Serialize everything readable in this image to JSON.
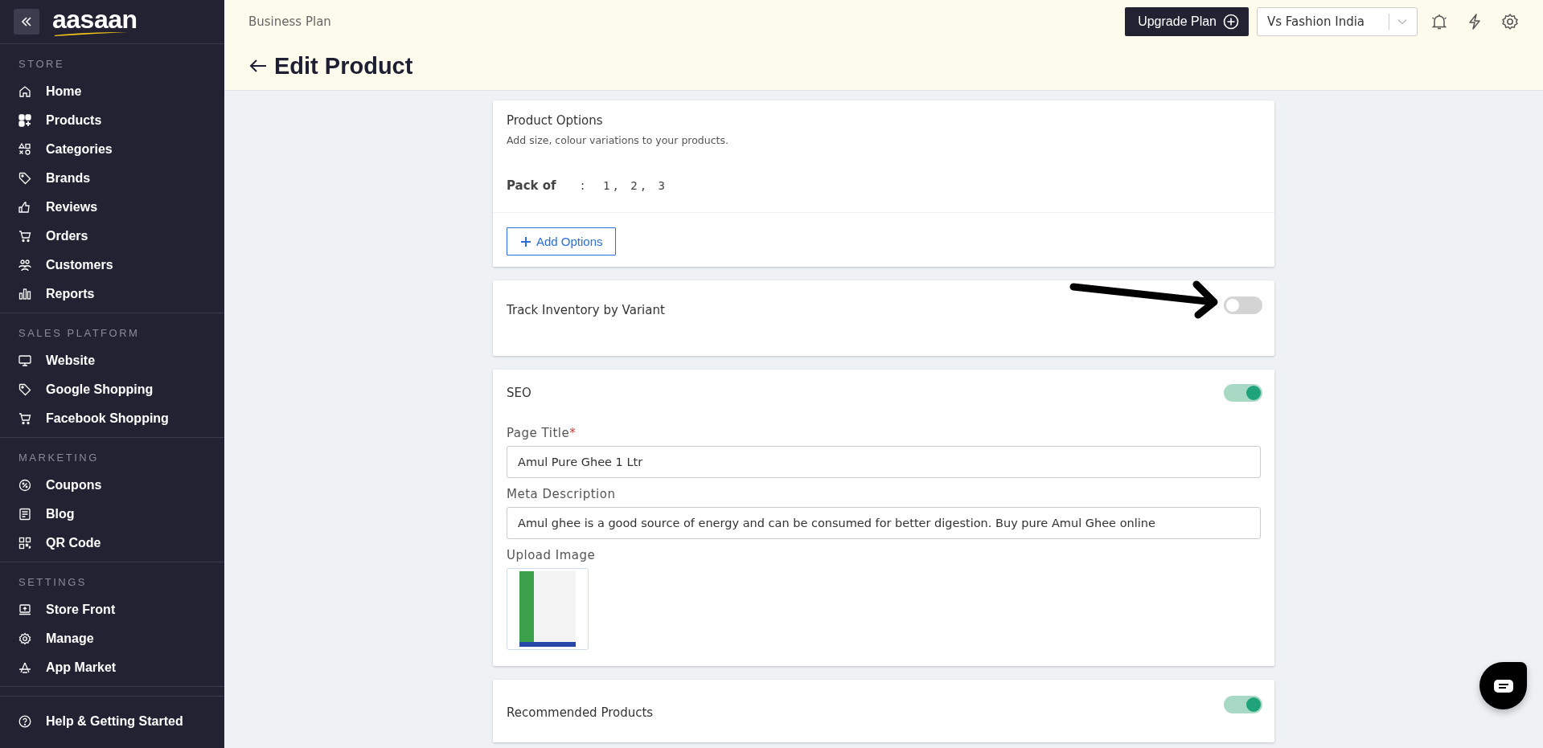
{
  "sidebar": {
    "logo": "aasaan",
    "sections": [
      {
        "title": "STORE",
        "items": [
          {
            "label": "Home"
          },
          {
            "label": "Products"
          },
          {
            "label": "Categories"
          },
          {
            "label": "Brands"
          },
          {
            "label": "Reviews"
          },
          {
            "label": "Orders"
          },
          {
            "label": "Customers"
          },
          {
            "label": "Reports"
          }
        ]
      },
      {
        "title": "SALES PLATFORM",
        "items": [
          {
            "label": "Website"
          },
          {
            "label": "Google Shopping"
          },
          {
            "label": "Facebook Shopping"
          }
        ]
      },
      {
        "title": "MARKETING",
        "items": [
          {
            "label": "Coupons"
          },
          {
            "label": "Blog"
          },
          {
            "label": "QR Code"
          }
        ]
      },
      {
        "title": "SETTINGS",
        "items": [
          {
            "label": "Store Front"
          },
          {
            "label": "Manage"
          },
          {
            "label": "App Market"
          }
        ]
      }
    ],
    "footer": {
      "label": "Help & Getting Started"
    }
  },
  "header": {
    "plan": "Business Plan",
    "upgrade_button": "Upgrade Plan",
    "store_select": "Vs Fashion India",
    "page_title": "Edit Product"
  },
  "product_options": {
    "title": "Product Options",
    "subtitle": "Add size, colour variations to your products.",
    "options": [
      {
        "name": "Pack of",
        "separator": ":",
        "values": "1, 2, 3"
      }
    ],
    "add_button": "Add Options"
  },
  "track_inventory": {
    "title": "Track Inventory by Variant",
    "on": false
  },
  "seo": {
    "title": "SEO",
    "on": true,
    "page_title_label": "Page Title",
    "required_mark": "*",
    "page_title_value": "Amul Pure Ghee 1 Ltr",
    "meta_label": "Meta Description",
    "meta_value": "Amul ghee is a good source of energy and can be consumed for better digestion. Buy pure Amul Ghee online",
    "upload_label": "Upload Image"
  },
  "recommended": {
    "title": "Recommended Products",
    "on": true
  }
}
